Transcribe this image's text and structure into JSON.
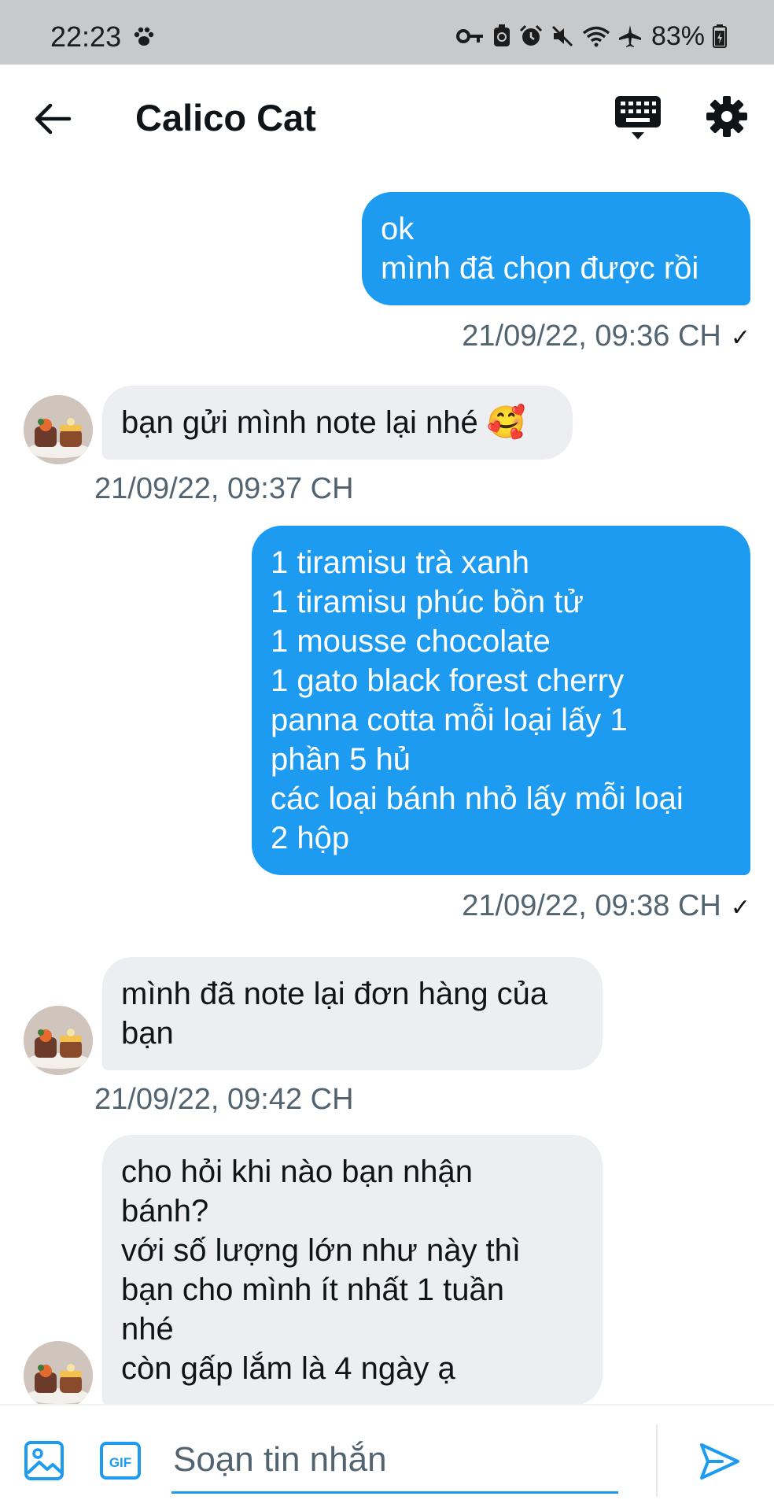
{
  "status_bar": {
    "time": "22:23",
    "battery": "83%",
    "icons": [
      "paw-icon",
      "key-icon",
      "recycle-icon",
      "alarm-icon",
      "mute-icon",
      "wifi-icon",
      "airplane-icon",
      "battery-icon"
    ]
  },
  "header": {
    "title": "Calico Cat",
    "icons": [
      "back-arrow-icon",
      "keyboard-icon",
      "settings-gear-icon"
    ]
  },
  "messages": [
    {
      "direction": "outgoing",
      "lines": [
        "ok",
        "mình đã chọn được rồi"
      ],
      "timestamp": "21/09/22, 09:36 CH",
      "status": "✓"
    },
    {
      "direction": "incoming",
      "lines": [
        "bạn gửi mình note lại nhé 🥰"
      ],
      "timestamp": "21/09/22, 09:37 CH"
    },
    {
      "direction": "outgoing",
      "lines": [
        "1 tiramisu trà xanh",
        "1 tiramisu phúc bồn tử",
        "1 mousse chocolate",
        "1 gato black forest cherry",
        "panna cotta mỗi loại lấy 1",
        "phần 5 hủ",
        "các loại bánh nhỏ lấy mỗi loại",
        "2 hộp"
      ],
      "timestamp": "21/09/22, 09:38 CH",
      "status": "✓"
    },
    {
      "direction": "incoming",
      "lines": [
        "mình đã note lại đơn hàng của",
        "bạn"
      ],
      "timestamp": "21/09/22, 09:42 CH"
    },
    {
      "direction": "incoming",
      "lines": [
        "cho hỏi khi nào bạn nhận",
        "bánh?",
        "với số lượng lớn như này thì",
        "bạn cho mình ít nhất 1 tuần",
        "nhé",
        "còn gấp lắm là 4 ngày ạ"
      ]
    }
  ],
  "composer": {
    "placeholder": "Soạn tin nhắn",
    "gif_label": "GIF",
    "icons": [
      "image-icon",
      "gif-icon",
      "send-icon"
    ]
  },
  "colors": {
    "accent": "#1d9bf0",
    "incoming_bubble": "#eceef1",
    "timestamp": "#536471",
    "status_bar": "#c8c9cb"
  }
}
